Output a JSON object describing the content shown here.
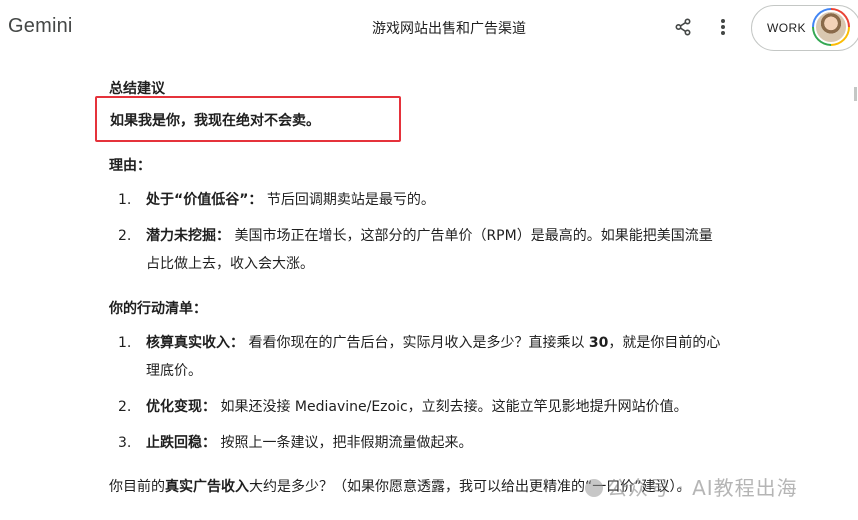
{
  "header": {
    "brand": "Gemini",
    "chat_title": "游戏网站出售和广告渠道",
    "work_label": "WORK"
  },
  "response": {
    "summary_heading": "总结建议",
    "highlight": "如果我是你，我现在绝对不会卖。",
    "reasons_heading": "理由：",
    "reasons": [
      {
        "num": "1.",
        "bold": "处于“价值低谷”：",
        "text": " 节后回调期卖站是最亏的。"
      },
      {
        "num": "2.",
        "bold": "潜力未挖掘：",
        "text": " 美国市场正在增长，这部分的广告单价（RPM）是最高的。如果能把美国流量",
        "text2": "占比做上去，收入会大涨。"
      }
    ],
    "actions_heading": "你的行动清单：",
    "actions": [
      {
        "num": "1.",
        "bold": "核算真实收入：",
        "text_a": " 看看你现在的广告后台，实际月收入是多少？直接乘以 ",
        "bold2": "30",
        "text_b": "，就是你目前的心",
        "text2": "理底价。"
      },
      {
        "num": "2.",
        "bold": "优化变现：",
        "text": " 如果还没接 Mediavine/Ezoic，立刻去接。这能立竿见影地提升网站价值。"
      },
      {
        "num": "3.",
        "bold": "止跌回稳：",
        "text": " 按照上一条建议，把非假期流量做起来。"
      }
    ],
    "closing": {
      "a": "你目前的",
      "bold": "真实广告收入",
      "b": "大约是多少？（如果你愿意透露，我可以给出更精准的“一口价”建议）。"
    }
  },
  "watermark": "公众号 · AI教程出海"
}
